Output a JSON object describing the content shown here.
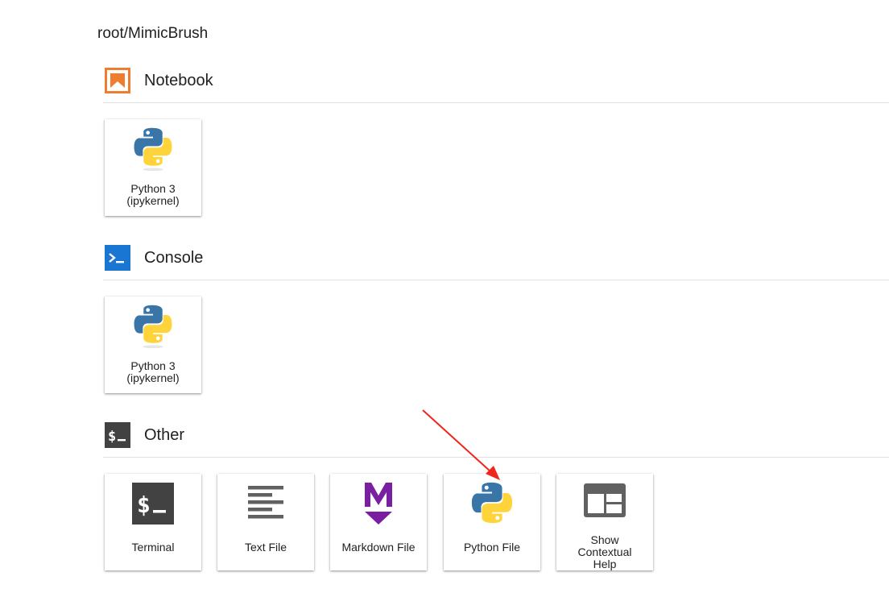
{
  "path": "root/MimicBrush",
  "sections": {
    "notebook": {
      "title": "Notebook",
      "icon": "notebook-icon",
      "items": [
        {
          "label": "Python 3\n(ipykernel)",
          "icon": "python-logo-icon"
        }
      ]
    },
    "console": {
      "title": "Console",
      "icon": "console-icon",
      "items": [
        {
          "label": "Python 3\n(ipykernel)",
          "icon": "python-logo-icon"
        }
      ]
    },
    "other": {
      "title": "Other",
      "icon": "terminal-icon",
      "items": [
        {
          "label": "Terminal",
          "icon": "terminal-icon"
        },
        {
          "label": "Text File",
          "icon": "text-file-icon"
        },
        {
          "label": "Markdown File",
          "icon": "markdown-icon"
        },
        {
          "label": "Python File",
          "icon": "python-logo-icon"
        },
        {
          "label": "Show\nContextual\nHelp",
          "icon": "contextual-help-icon"
        }
      ]
    }
  },
  "annotation": {
    "type": "arrow",
    "points_to": "Python File",
    "color": "#f0261c"
  },
  "colors": {
    "notebook_accent": "#ef7c2f",
    "console_accent": "#1976d2",
    "terminal_bg": "#424242",
    "markdown_accent": "#7b1fa2",
    "python_blue": "#3a75a8",
    "python_yellow": "#ffd43b"
  }
}
